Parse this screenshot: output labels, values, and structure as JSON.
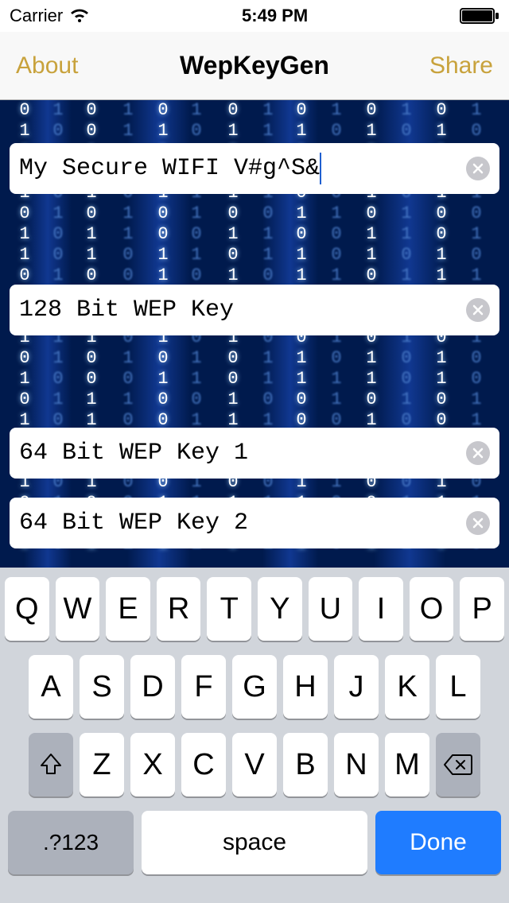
{
  "status": {
    "carrier": "Carrier",
    "time": "5:49 PM"
  },
  "nav": {
    "left": "About",
    "title": "WepKeyGen",
    "right": "Share"
  },
  "fields": {
    "input_value": "My Secure WIFI V#g^S&",
    "key128": "128 Bit WEP Key",
    "key64_1": "64 Bit WEP Key 1",
    "key64_2": "64 Bit WEP Key 2"
  },
  "keyboard": {
    "row1": [
      "Q",
      "W",
      "E",
      "R",
      "T",
      "Y",
      "U",
      "I",
      "O",
      "P"
    ],
    "row2": [
      "A",
      "S",
      "D",
      "F",
      "G",
      "H",
      "J",
      "K",
      "L"
    ],
    "row3": [
      "Z",
      "X",
      "C",
      "V",
      "B",
      "N",
      "M"
    ],
    "mode": ".?123",
    "space": "space",
    "done": "Done"
  }
}
